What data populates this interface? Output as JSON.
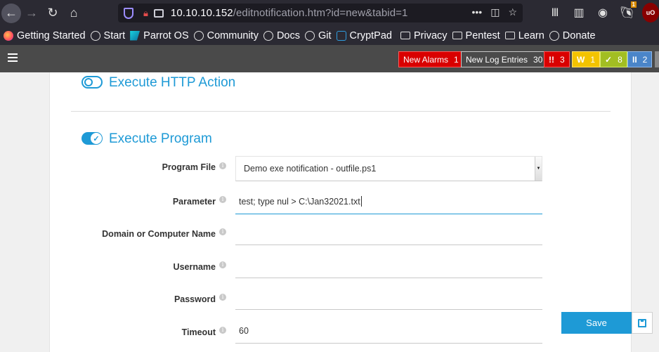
{
  "browser": {
    "url_host": "10.10.10.152",
    "url_path": "/editnotification.htm?id=new&tabid=1",
    "url_more": "•••",
    "bookmarks": [
      {
        "label": "Getting Started",
        "icon": "firefox-icon"
      },
      {
        "label": "Start",
        "icon": "globe-icon"
      },
      {
        "label": "Parrot OS",
        "icon": "parrot-icon"
      },
      {
        "label": "Community",
        "icon": "globe-icon"
      },
      {
        "label": "Docs",
        "icon": "globe-icon"
      },
      {
        "label": "Git",
        "icon": "globe-icon"
      },
      {
        "label": "CryptPad",
        "icon": "cryptpad-icon"
      },
      {
        "label": "Privacy",
        "icon": "folder-icon"
      },
      {
        "label": "Pentest",
        "icon": "folder-icon"
      },
      {
        "label": "Learn",
        "icon": "folder-icon"
      },
      {
        "label": "Donate",
        "icon": "globe-icon"
      }
    ],
    "ublock_badge": "uO",
    "extension_badge": "1"
  },
  "appbar": {
    "new_alarms": {
      "label": "New Alarms",
      "count": "1"
    },
    "new_log_entries": {
      "label": "New Log Entries",
      "count": "30"
    },
    "errors": {
      "icon": "!!",
      "count": "3"
    },
    "warnings": {
      "icon": "W",
      "count": "1"
    },
    "ok": {
      "icon": "✓",
      "count": "8"
    },
    "paused": {
      "icon": "II",
      "count": "2"
    }
  },
  "sections": {
    "http_action": {
      "title": "Execute HTTP Action",
      "enabled": false
    },
    "program": {
      "title": "Execute Program",
      "enabled": true
    }
  },
  "form": {
    "program_file": {
      "label": "Program File",
      "value": "Demo exe notification - outfile.ps1"
    },
    "parameter": {
      "label": "Parameter",
      "value": "test; type nul > C:\\Jan32021.txt"
    },
    "domain": {
      "label": "Domain or Computer Name",
      "value": ""
    },
    "username": {
      "label": "Username",
      "value": ""
    },
    "password": {
      "label": "Password",
      "value": ""
    },
    "timeout": {
      "label": "Timeout",
      "value": "60"
    }
  },
  "actions": {
    "save_label": "Save"
  },
  "colors": {
    "accent": "#1e9ad6",
    "alarm_red": "#d90000",
    "warning_yellow": "#f3c300",
    "ok_green": "#a2be22",
    "paused_blue": "#4a85c9"
  }
}
